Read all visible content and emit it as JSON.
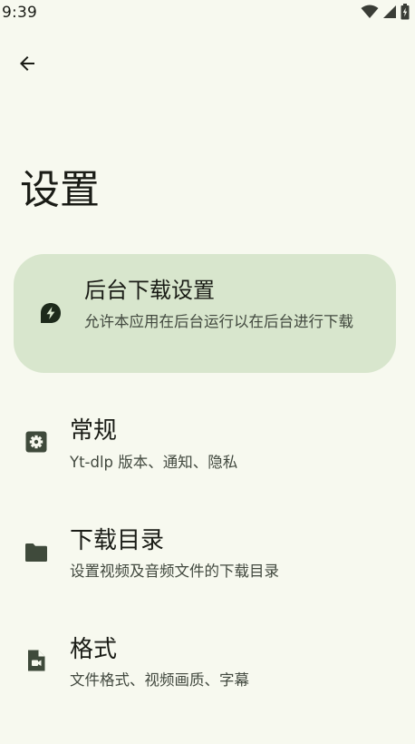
{
  "status_bar": {
    "time": "9:39",
    "icons": [
      "wifi-icon",
      "cellular-signal-icon",
      "battery-charging-icon"
    ]
  },
  "app_bar": {
    "back_icon": "arrow-back-icon"
  },
  "page": {
    "title": "设置"
  },
  "background_download_card": {
    "icon": "bolt-leaf-icon",
    "title": "后台下载设置",
    "description": "允许本应用在后台运行以在后台进行下载"
  },
  "settings": [
    {
      "icon": "settings-gear-icon",
      "title": "常规",
      "description": "Yt-dlp 版本、通知、隐私"
    },
    {
      "icon": "folder-icon",
      "title": "下载目录",
      "description": "设置视频及音频文件的下载目录"
    },
    {
      "icon": "video-file-icon",
      "title": "格式",
      "description": "文件格式、视频画质、字幕"
    }
  ],
  "colors": {
    "background": "#F7F9EF",
    "card_background": "#D8E6CD",
    "primary_text": "#1A1C16",
    "secondary_text": "#42493F",
    "icon": "#3F4A3B"
  }
}
